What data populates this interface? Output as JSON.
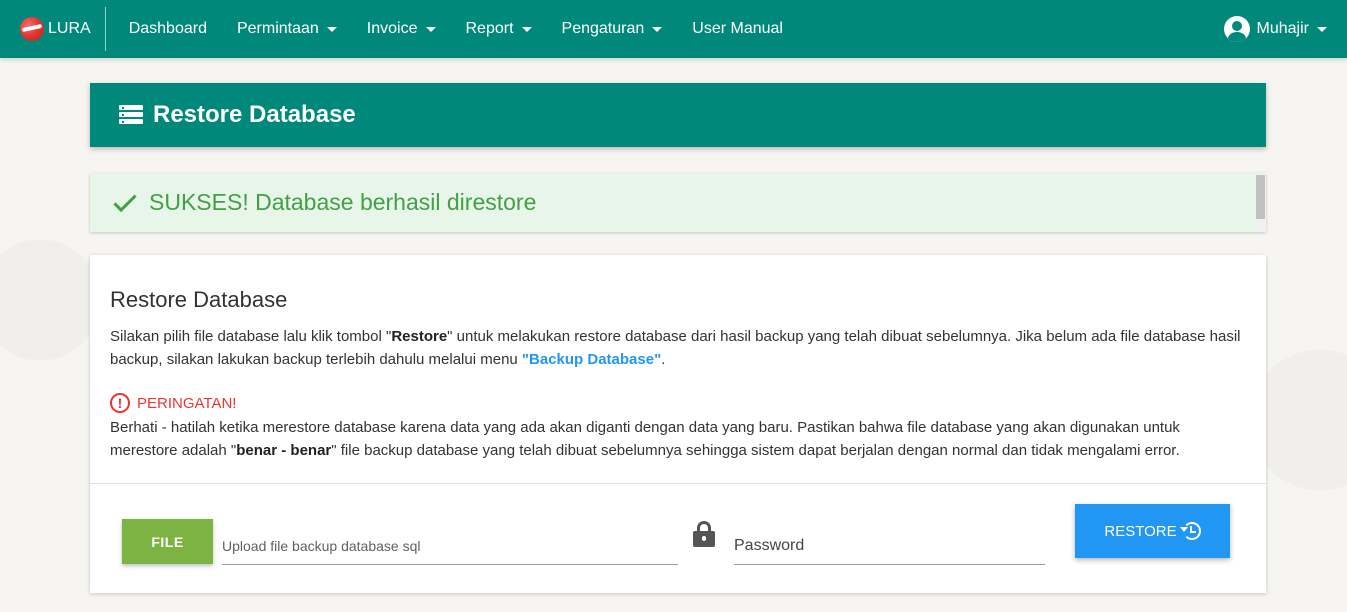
{
  "navbar": {
    "brand": "LURA",
    "items": [
      {
        "label": "Dashboard",
        "dropdown": false
      },
      {
        "label": "Permintaan",
        "dropdown": true
      },
      {
        "label": "Invoice",
        "dropdown": true
      },
      {
        "label": "Report",
        "dropdown": true
      },
      {
        "label": "Pengaturan",
        "dropdown": true
      },
      {
        "label": "User Manual",
        "dropdown": false
      }
    ],
    "user": "Muhajir"
  },
  "header": {
    "title": "Restore Database"
  },
  "alert": {
    "message": "SUKSES! Database berhasil direstore"
  },
  "card": {
    "title": "Restore Database",
    "desc_part1": "Silakan pilih file database lalu klik tombol \"",
    "desc_bold": "Restore",
    "desc_part2": "\" untuk melakukan restore database dari hasil backup yang telah dibuat sebelumnya. Jika belum ada file database hasil backup, silakan lakukan backup terlebih dahulu melalui menu ",
    "desc_link": "\"Backup Database\"",
    "desc_end": ".",
    "warning_title": "PERINGATAN!",
    "warning_part1": "Berhati - hatilah ketika merestore database karena data yang ada akan diganti dengan data yang baru. Pastikan bahwa file database yang akan digunakan untuk merestore adalah \"",
    "warning_bold": "benar - benar",
    "warning_part2": "\" file backup database yang telah dibuat sebelumnya sehingga sistem dapat berjalan dengan normal dan tidak mengalami error."
  },
  "form": {
    "file_button": "FILE",
    "file_placeholder": "Upload file backup database sql",
    "password_placeholder": "Password",
    "restore_button": "RESTORE"
  },
  "colors": {
    "primary": "#00897b",
    "success_bg": "#e8f5e9",
    "success_text": "#43a047",
    "warning": "#e53935",
    "file_button": "#7cb342",
    "restore_button": "#2196f3",
    "link": "#2196f3"
  }
}
